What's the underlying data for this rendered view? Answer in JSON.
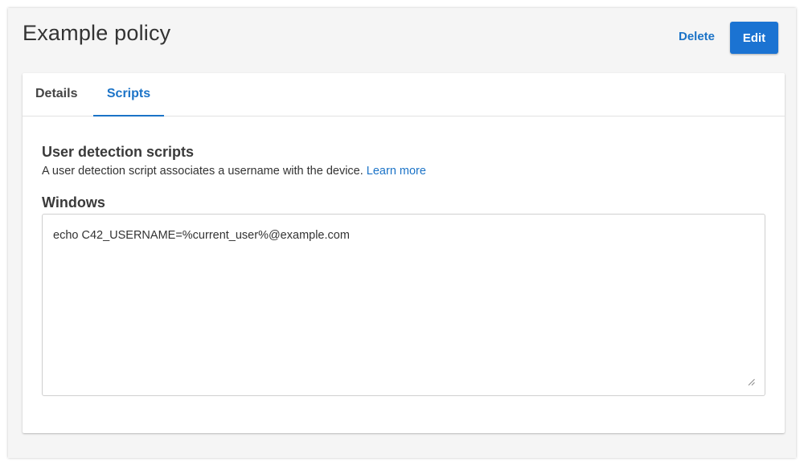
{
  "header": {
    "title": "Example policy",
    "delete_label": "Delete",
    "edit_label": "Edit"
  },
  "tabs": [
    {
      "label": "Details",
      "active": false
    },
    {
      "label": "Scripts",
      "active": true
    }
  ],
  "scripts_section": {
    "heading": "User detection scripts",
    "description": "A user detection script associates a username with the device.",
    "learn_more_label": "Learn more",
    "windows": {
      "label": "Windows",
      "script_value": "echo C42_USERNAME=%current_user%@example.com"
    }
  },
  "colors": {
    "accent": "#1b73c7",
    "button_bg": "#1b73d2",
    "page_bg": "#f5f5f5"
  },
  "icons": {
    "resize_handle": "resize-handle-icon"
  }
}
